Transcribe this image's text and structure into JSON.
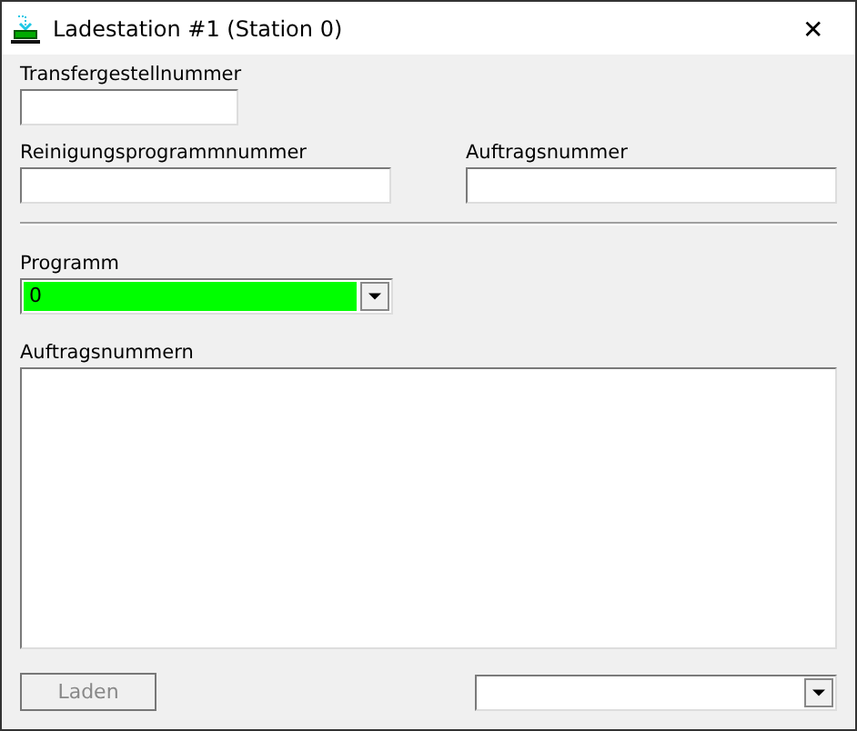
{
  "window": {
    "title": "Ladestation #1 (Station 0)",
    "close": "✕"
  },
  "transfer": {
    "label": "Transfergestellnummer"
  },
  "cleaning": {
    "label": "Reinigungsprogrammnummer"
  },
  "order": {
    "label": "Auftragsnummer"
  },
  "program": {
    "label": "Programm",
    "value": "0",
    "color": "#00ff00"
  },
  "orders": {
    "label": "Auftragsnummern"
  },
  "load_button": {
    "label": "Laden",
    "disabled": true
  }
}
